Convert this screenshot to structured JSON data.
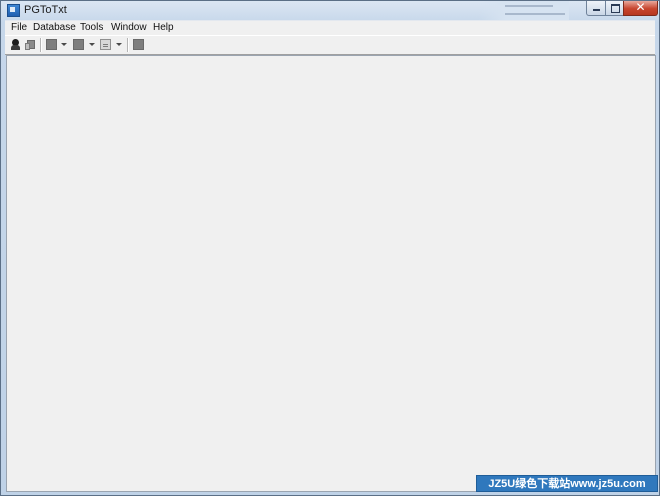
{
  "window": {
    "title": "PGToTxt",
    "close_glyph": "✕"
  },
  "menubar": {
    "items": [
      {
        "label": "File"
      },
      {
        "label": "Database"
      },
      {
        "label": "Tools"
      },
      {
        "label": "Window"
      },
      {
        "label": "Help"
      }
    ]
  },
  "toolbar": {
    "icons": [
      "connect-icon",
      "disconnect-icon",
      "new-task-icon",
      "open-task-icon",
      "query-icon",
      "run-icon"
    ]
  },
  "watermark": {
    "text": "JZ5U绿色下载站www.jz5u.com"
  },
  "colors": {
    "titlebar": "#c6d7ea",
    "client_bg": "#f0f0f0",
    "close_button": "#c7452e",
    "watermark_bg": "#2f78bd"
  }
}
